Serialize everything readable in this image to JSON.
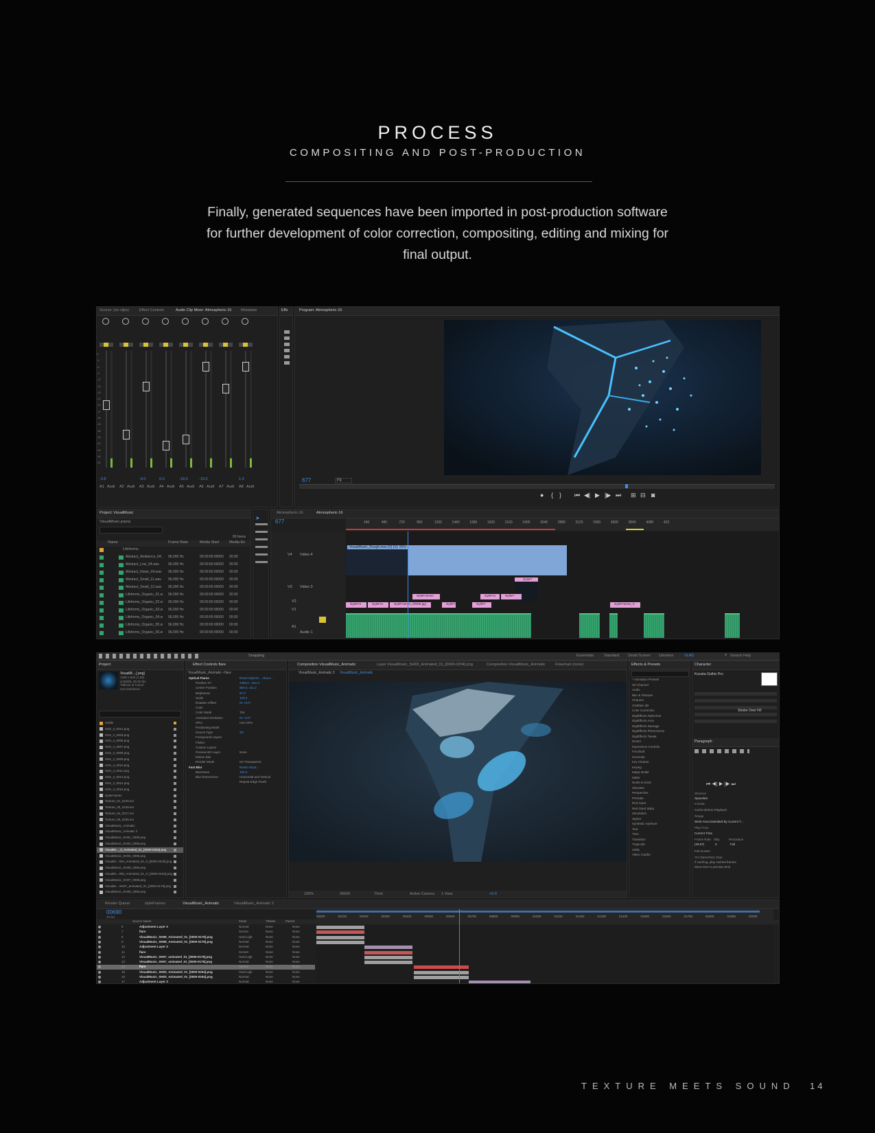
{
  "header": {
    "title": "PROCESS",
    "subtitle": "COMPOSITING AND POST-PRODUCTION",
    "intro_line1": "Finally, generated sequences have been imported in post-production software",
    "intro_line2": "for further development of color correction, compositing, editing and mixing for",
    "intro_line3": "final output."
  },
  "footer": {
    "book_title": "TEXTURE MEETS SOUND",
    "page_number": "14"
  },
  "premiere": {
    "top_tabs": [
      "Source: (no clips)",
      "Effect Controls",
      "Audio Clip Mixer: Atmospheric-16",
      "Metadata"
    ],
    "effects_tab": "Effs",
    "program_tab": "Program: Atmospheric-16",
    "program_timecode": "677",
    "program_fit": "Fit",
    "mixer_tracks": [
      "A1",
      "A2",
      "A3",
      "A4",
      "A5",
      "A6",
      "A7",
      "A8"
    ],
    "mixer_track_names": [
      "Audi",
      "Audi",
      "Audi",
      "Audi",
      "Audi",
      "Audi",
      "Audi",
      "Audi"
    ],
    "mixer_values": [
      "-3.8",
      "",
      "-9.0",
      "0.0",
      "-18.0",
      "-15.0",
      "",
      "1.0"
    ],
    "mixer_scale": [
      "0",
      "-3",
      "-6",
      "-9",
      "-12",
      "-15",
      "-18",
      "-21",
      "-24",
      "-27",
      "-30",
      "-33",
      "-36",
      "-39",
      "-42",
      "-45",
      "-48",
      "-51"
    ],
    "project_tab": "Project: VisualMusic",
    "project_file": "VisualMusic.prproj",
    "project_item_count": "65 Items",
    "project_columns": [
      "Name",
      "Frame Rate",
      "Media Start",
      "Media En"
    ],
    "project_folder": "Lifeforms",
    "project_items": [
      {
        "name": "Abstract_Ambience_04..",
        "rate": "96,000 Hz",
        "start": "00:00:00:00000",
        "end": "00:00"
      },
      {
        "name": "Abstract_Low_04.wav",
        "rate": "96,000 Hz",
        "start": "00:00:00:00000",
        "end": "00:00"
      },
      {
        "name": "Abstract_Noise_04.wav",
        "rate": "96,000 Hz",
        "start": "00:00:00:00000",
        "end": "00:00"
      },
      {
        "name": "Abstract_Small_11.wav",
        "rate": "96,000 Hz",
        "start": "00:00:00:00000",
        "end": "00:00"
      },
      {
        "name": "Abstract_Small_12.wav",
        "rate": "96,000 Hz",
        "start": "00:00:00:00000",
        "end": "00:00"
      },
      {
        "name": "Lifeforms_Organic_01.w",
        "rate": "96,000 Hz",
        "start": "00:00:00:00000",
        "end": "00:00"
      },
      {
        "name": "Lifeforms_Organic_02.w",
        "rate": "96,000 Hz",
        "start": "00:00:00:00000",
        "end": "00:00"
      },
      {
        "name": "Lifeforms_Organic_03.w",
        "rate": "96,000 Hz",
        "start": "00:00:00:00000",
        "end": "00:00"
      },
      {
        "name": "Lifeforms_Organic_04.w",
        "rate": "96,000 Hz",
        "start": "00:00:00:00000",
        "end": "00:00"
      },
      {
        "name": "Lifeforms_Organic_05.w",
        "rate": "96,000 Hz",
        "start": "00:00:00:00000",
        "end": "00:00"
      },
      {
        "name": "Lifeforms_Organic_06.w",
        "rate": "96,000 Hz",
        "start": "00:00:00:00000",
        "end": "00:00"
      }
    ],
    "timeline_tabs": [
      "Atmospheric-16",
      "Atmospheric-16"
    ],
    "timeline_timecode": "677",
    "ruler_labels": [
      "240",
      "480",
      "720",
      "960",
      "1200",
      "1440",
      "1680",
      "1920",
      "2160",
      "2400",
      "2640",
      "2880",
      "3120",
      "3360",
      "3600",
      "3840",
      "4080",
      "432"
    ],
    "tracks": [
      {
        "id": "V4",
        "name": "Video 4"
      },
      {
        "id": "V3",
        "name": "Video 3"
      },
      {
        "id": "V2",
        "name": ""
      },
      {
        "id": "V1",
        "name": ""
      },
      {
        "id": "A1",
        "name": "Audio 1"
      }
    ],
    "v4_clip_label": "VisualMusic_Rough.mov [V] [V]: 25%",
    "v3_clip_label": "styleFr",
    "v2_clips": [
      "styleFrames",
      "styleFra",
      "styleFr"
    ],
    "v1_clips": [
      "styleFra",
      "styleFra",
      "styleFrames_00008.jpg",
      "styleFr",
      "styleFr",
      "styleFrames_0"
    ],
    "colors": {
      "audio_clip": "#35a36e",
      "video_clip": "#e2a1d6",
      "selected_clip": "#7fa6d6",
      "work_area": "#d4d23a"
    }
  },
  "aftereffects": {
    "workspaces": [
      "Essentials",
      "Standard",
      "Small Screen",
      "Libraries",
      "VLAD"
    ],
    "search_help": "Search Help",
    "snapping": "Snapping",
    "project_tab": "Project",
    "project_preview_name": "VisualM....[.png]",
    "project_preview_info": [
      "1280 x 600 (1.00)",
      "Δ 00205, 30.00 fps",
      "Trillions of Colors",
      "non-Interlaced"
    ],
    "project_items": [
      "Solids",
      "SSS_3_0014.png",
      "SSS_4_0003.png",
      "SSS_4_0006.png",
      "SSS_4_0007.png",
      "SSS_4_0008.png",
      "SSS_4_0009.png",
      "SSS_4_0010.png",
      "SSS_4_0011.png",
      "SSS_4_0013.png",
      "SSS_4_0014.png",
      "SSS_4_0015.png",
      "styleFrames",
      "Texture_01_0240.exr",
      "Texture_03_0139.exr",
      "Texture_04_0217.exr",
      "Texture_05_0236.exr",
      "VisualMusic_Animatic",
      "VisualMusic_Animatic 2",
      "VisualMusic_SH01_0096.png",
      "VisualMusic_SH02_0096.png",
      "VisualM..._3_Animated_01_[0000-0204].png",
      "VisualMusic_SH04_0096.png",
      "VisualM...H04_Animated_01_0_[0000-0215].png",
      "VisualMusic_SH05_0096.png",
      "VisualM...H06_Animated_01_H_[0000-0152].png",
      "VisualMusic_SH07_0096.png",
      "VisualM....SH07_animated_01_[0000-0179].png",
      "VisualMusic_SH08_0096.png"
    ],
    "effect_controls_tab": "Effect Controls flare",
    "effect_controls_layer": "VisualMusic_Animatic • flare",
    "effects": [
      {
        "label": "Optical Flares",
        "value": "Reset  Options...  About..."
      },
      {
        "label": "Position XY",
        "value": "2456.0, -461.0"
      },
      {
        "label": "Center Position",
        "value": "660.0, 411.0"
      },
      {
        "label": "Brightness",
        "value": "87.0"
      },
      {
        "label": "Scale",
        "value": "100.0"
      },
      {
        "label": "Rotation Offset",
        "value": "0x +0.0°"
      },
      {
        "label": "Color",
        "value": ""
      },
      {
        "label": "Color Mode",
        "value": "Tint"
      },
      {
        "label": "Animation Evolution",
        "value": "0x +0.0°"
      },
      {
        "label": "GPU",
        "value": "Use GPU"
      },
      {
        "label": "Positioning Mode",
        "value": ""
      },
      {
        "label": "Source Type",
        "value": "2D"
      },
      {
        "label": "Foreground Layers",
        "value": ""
      },
      {
        "label": "Flicker",
        "value": ""
      },
      {
        "label": "Custom Layers",
        "value": ""
      },
      {
        "label": "Preview BG Layer",
        "value": "None"
      },
      {
        "label": "Motion Blur",
        "value": ""
      },
      {
        "label": "Render Mode",
        "value": "On Transparent"
      },
      {
        "label": "Fast Blur",
        "value": "Reset  About..."
      },
      {
        "label": "Blurriness",
        "value": "100.0"
      },
      {
        "label": "Blur Dimensions",
        "value": "Horizontal and Vertical"
      },
      {
        "label": "",
        "value": "Repeat Edge Pixels"
      }
    ],
    "viewer_tabs": [
      "Composition VisualMusic_Animatic",
      "Layer VisualMusic_SH03_Animated_01_[0000-0204].png",
      "Composition VisualMusic_Animatic",
      "Flowchart (none)"
    ],
    "viewer_breadcrumbs": [
      "VisualMusic_Animatic 2",
      "VisualMusic_Animatic"
    ],
    "viewer_footer": [
      "100%",
      "00690",
      "Third",
      "Active Camera",
      "1 View",
      "+0.0"
    ],
    "effects_presets_tab": "Effects & Presets",
    "effects_categories": [
      "* Animation Presets",
      "3D Channel",
      "Audio",
      "Blur & Sharpen",
      "Channel",
      "CINEMA 4D",
      "Color Correction",
      "DigiEffects AlphaTool",
      "DigiEffects Aura",
      "DigiEffects Damage",
      "DigiEffects Phenomena",
      "DigiEffects Tweak",
      "Distort",
      "Expression Controls",
      "Frischluft",
      "Generate",
      "Key Cleaner",
      "Keying",
      "Magic Bullet",
      "Matte",
      "Noise & Grain",
      "Obsolete",
      "Perspective",
      "Primatte",
      "Red Giant",
      "Red Giant Warp",
      "Simulation",
      "Stylize",
      "Synthetic Aperture",
      "Text",
      "Time",
      "Transition",
      "Trapcode",
      "Utility",
      "Video Copilot"
    ],
    "character_tab": "Character",
    "character_font": "Kozuka Gothic Pro",
    "character_stroke": "Stroke Over Fill",
    "paragraph_tab": "Paragraph",
    "preview": {
      "shortcut_label": "Shortcut",
      "shortcut": "Spacebar",
      "include_label": "Include:",
      "cache_option": "Cache Before Playback",
      "range_label": "Range",
      "range": "Work Area Extended By Current T...",
      "play_from_label": "Play From",
      "play_from": "Current Time",
      "frame_rate_label": "Frame Rate",
      "skip_label": "Skip",
      "resolution_label": "Resolution",
      "frame_rate": "(29.97)",
      "skip": "0",
      "resolution": "Full",
      "full_screen": "Full Screen",
      "on_stop_label": "On (Spacebar) Stop:",
      "on_stop_1": "If caching, play cached frames",
      "on_stop_2": "Move time to preview time"
    },
    "timeline_tabs": [
      "Render Queue",
      "styleFrames",
      "VisualMusic_Animatic",
      "VisualMusic_Animatic 2"
    ],
    "timeline_timecode": "00690",
    "timeline_fps": "30 fps",
    "timeline_columns": [
      "Source Name",
      "Mode",
      "TrkMat",
      "Parent"
    ],
    "ruler_labels": [
      "00000",
      "00100",
      "00200",
      "00300",
      "00400",
      "00500",
      "00600",
      "00700",
      "00800",
      "00900",
      "01000",
      "01100",
      "01200",
      "01300",
      "01400",
      "01500",
      "01600",
      "01700",
      "01800",
      "01900",
      "02000"
    ],
    "layers": [
      {
        "num": "6",
        "name": "Adjustment Layer 3",
        "mode": "Normal",
        "trk": "None",
        "parent": "None",
        "color": "#a0a0a0"
      },
      {
        "num": "7",
        "name": "flare",
        "mode": "Screen",
        "trk": "None",
        "parent": "None",
        "color": "#c45858"
      },
      {
        "num": "8",
        "name": "VisualMusic_SH08_Animated_01_[0000-0179].png",
        "mode": "Hard Ligh",
        "trk": "None",
        "parent": "None",
        "color": "#a0a0a0"
      },
      {
        "num": "9",
        "name": "VisualMusic_SH08_Animated_01_[0000-0179].png",
        "mode": "Normal",
        "trk": "None",
        "parent": "None",
        "color": "#a0a0a0"
      },
      {
        "num": "10",
        "name": "Adjustment Layer 3",
        "mode": "Normal",
        "trk": "None",
        "parent": "None",
        "color": "#a58fb0"
      },
      {
        "num": "11",
        "name": "flare",
        "mode": "Screen",
        "trk": "None",
        "parent": "None",
        "color": "#c45858"
      },
      {
        "num": "12",
        "name": "VisualMusic_SH07_animated_01_[0000-0179].png",
        "mode": "Hard Ligh",
        "trk": "None",
        "parent": "None",
        "color": "#a0a0a0"
      },
      {
        "num": "13",
        "name": "VisualMusic_SH07_animated_01_[0000-0179].png",
        "mode": "Normal",
        "trk": "None",
        "parent": "None",
        "color": "#a0a0a0"
      },
      {
        "num": "14",
        "name": "flare",
        "mode": "Screen",
        "trk": "None",
        "parent": "None",
        "color": "#d04a4a"
      },
      {
        "num": "15",
        "name": "VisualMusic_SH03_Animated_01_[0000-0204].png",
        "mode": "Hard Ligh",
        "trk": "None",
        "parent": "None",
        "color": "#a0a0a0"
      },
      {
        "num": "16",
        "name": "VisualMusic_SH03_Animated_01_[0000-0204].png",
        "mode": "Normal",
        "trk": "None",
        "parent": "None",
        "color": "#a0a0a0"
      },
      {
        "num": "17",
        "name": "Adjustment Layer 3",
        "mode": "Normal",
        "trk": "None",
        "parent": "None",
        "color": "#a58fb0"
      }
    ]
  }
}
